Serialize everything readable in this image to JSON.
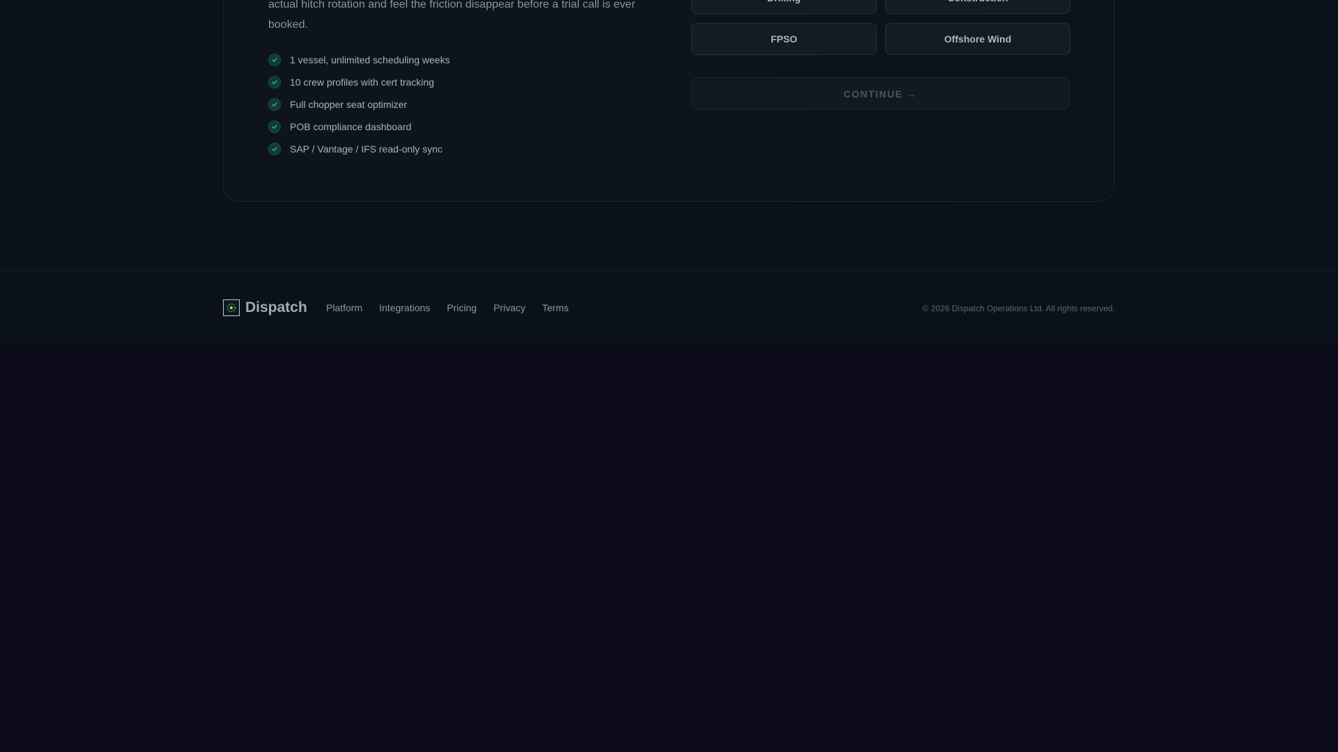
{
  "plan": {
    "description": "actual hitch rotation and feel the friction disappear before a trial call is ever booked.",
    "features": [
      "1 vessel, unlimited scheduling weeks",
      "10 crew profiles with cert tracking",
      "Full chopper seat optimizer",
      "POB compliance dashboard",
      "SAP / Vantage / IFS read-only sync"
    ]
  },
  "segment": {
    "options": [
      "Drilling",
      "Construction",
      "FPSO",
      "Offshore Wind"
    ],
    "continue_label": "CONTINUE →"
  },
  "footer": {
    "brand": "Dispatch",
    "links": [
      "Platform",
      "Integrations",
      "Pricing",
      "Privacy",
      "Terms"
    ],
    "copyright": "© 2026 Dispatch Operations Ltd. All rights reserved."
  },
  "colors": {
    "accent": "#2bb7a0",
    "background": "#0b111a",
    "page": "#0a0a18"
  }
}
